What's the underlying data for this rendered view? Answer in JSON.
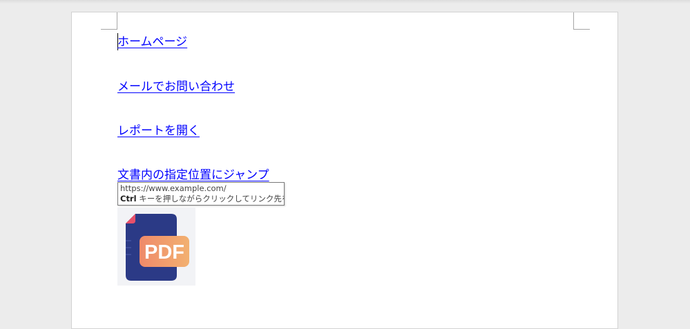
{
  "document": {
    "links": [
      {
        "label": "ホームページ"
      },
      {
        "label": "メールでお問い合わせ"
      },
      {
        "label": "レポートを開く"
      },
      {
        "label": "文書内の指定位置にジャンプ"
      }
    ],
    "tooltip": {
      "url": "https://www.example.com/",
      "hint_key": "Ctrl",
      "hint_text": " キーを押しながらクリックしてリンク先を表示"
    },
    "image": {
      "label": "PDF",
      "icon": "pdf-file-icon",
      "colors": {
        "document_body": "#2b3a86",
        "corner_fold": "#e8506a",
        "badge_start": "#ef8a6a",
        "badge_end": "#f2b070",
        "badge_text": "#ffffff"
      }
    },
    "colors": {
      "link": "#0000ff",
      "page_background": "#ffffff",
      "workspace_background": "#ececec"
    }
  }
}
